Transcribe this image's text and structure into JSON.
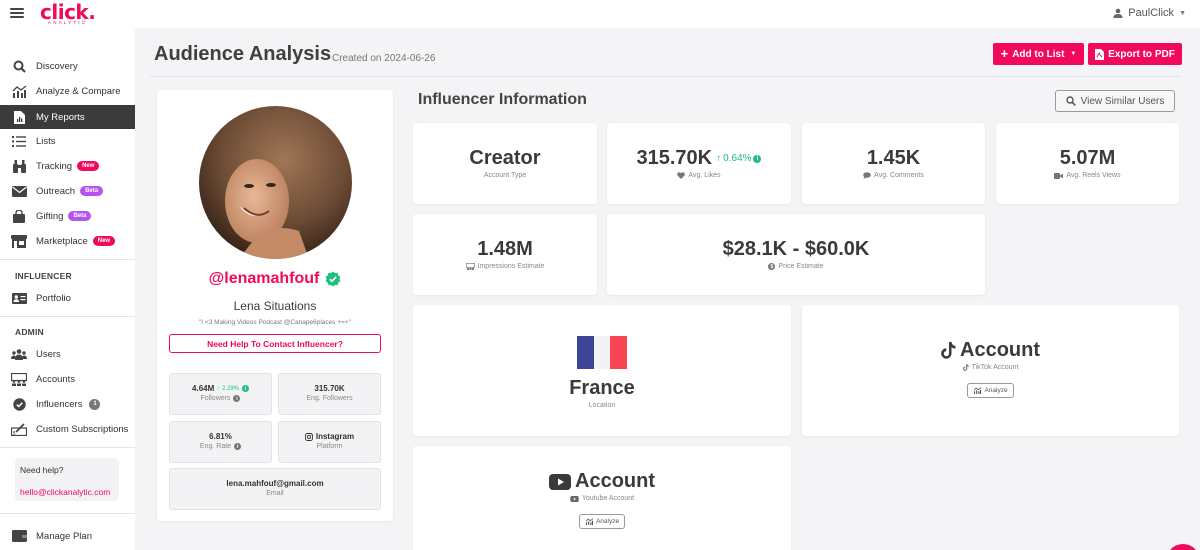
{
  "app": {
    "brand": "click.",
    "brand_sub": "ANALYTIC",
    "user_name": "PaulClick"
  },
  "sidebar": {
    "items": [
      {
        "label": "Discovery",
        "icon": "search-icon"
      },
      {
        "label": "Analyze & Compare",
        "icon": "analyze-chart-icon"
      },
      {
        "label": "My Reports",
        "icon": "report-file-icon",
        "active": true
      },
      {
        "label": "Lists",
        "icon": "list-icon"
      },
      {
        "label": "Tracking",
        "icon": "binoculars-icon",
        "badge": "New"
      },
      {
        "label": "Outreach",
        "icon": "envelope-icon",
        "badge": "Beta"
      },
      {
        "label": "Gifting",
        "icon": "shopping-bag-icon",
        "badge": "Beta"
      },
      {
        "label": "Marketplace",
        "icon": "store-icon",
        "badge": "New"
      }
    ],
    "influencer_section": {
      "title": "INFLUENCER",
      "items": [
        {
          "label": "Portfolio",
          "icon": "id-card-icon"
        }
      ]
    },
    "admin_section": {
      "title": "ADMIN",
      "items": [
        {
          "label": "Users",
          "icon": "users-icon"
        },
        {
          "label": "Accounts",
          "icon": "accounts-icon"
        },
        {
          "label": "Influencers",
          "icon": "verified-badge-icon",
          "count": "1"
        },
        {
          "label": "Custom Subscriptions",
          "icon": "signature-icon"
        }
      ]
    },
    "help": {
      "title": "Need help?",
      "email": "hello@clickanalytic.com"
    },
    "manage_plan": {
      "label": "Manage Plan",
      "icon": "wallet-icon"
    }
  },
  "header": {
    "title": "Audience Analysis",
    "created": "Created on 2024-06-26",
    "add_to_list": "Add to List",
    "export_pdf": "Export to PDF"
  },
  "profile": {
    "handle": "@lenamahfouf",
    "verified": true,
    "name": "Lena Situations",
    "bio": "\"I <3 Making Videos Podcast @Canape6places +=+\"",
    "contact_button": "Need Help To Contact Influencer?",
    "stats": {
      "followers": {
        "value": "4.64M",
        "trend": "2.29%",
        "label": "Followers"
      },
      "eng_followers": {
        "value": "315.70K",
        "label": "Eng. Followers"
      },
      "eng_rate": {
        "value": "6.81%",
        "label": "Eng. Rate"
      },
      "platform": {
        "value": "Instagram",
        "label": "Platform"
      },
      "email": {
        "value": "lena.mahfouf@gmail.com",
        "label": "Email"
      }
    }
  },
  "influencer_info": {
    "title": "Influencer Information",
    "view_similar": "View Similar Users",
    "cards": {
      "account_type": {
        "value": "Creator",
        "label": "Account Type"
      },
      "avg_likes": {
        "value": "315.70K",
        "trend": "0.64%",
        "label": "Avg. Likes"
      },
      "avg_comments": {
        "value": "1.45K",
        "label": "Avg. Comments"
      },
      "avg_reels_views": {
        "value": "5.07M",
        "label": "Avg. Reels Views"
      },
      "impressions": {
        "value": "1.48M",
        "label": "Impressions Estimate"
      },
      "price": {
        "value": "$28.1K - $60.0K",
        "label": "Price Estimate"
      },
      "location": {
        "value": "France",
        "label": "Location"
      },
      "tiktok": {
        "value": "Account",
        "label": "TikTok Account",
        "button": "Analyze"
      },
      "youtube": {
        "value": "Account",
        "label": "Youtube Account",
        "button": "Analyze"
      }
    }
  },
  "colors": {
    "accent": "#f0095c",
    "beta": "#b453f0",
    "positive": "#1fbf7d",
    "flag_blue": "#3d4497",
    "flag_white": "#f3f3f6",
    "flag_red": "#f94452"
  }
}
